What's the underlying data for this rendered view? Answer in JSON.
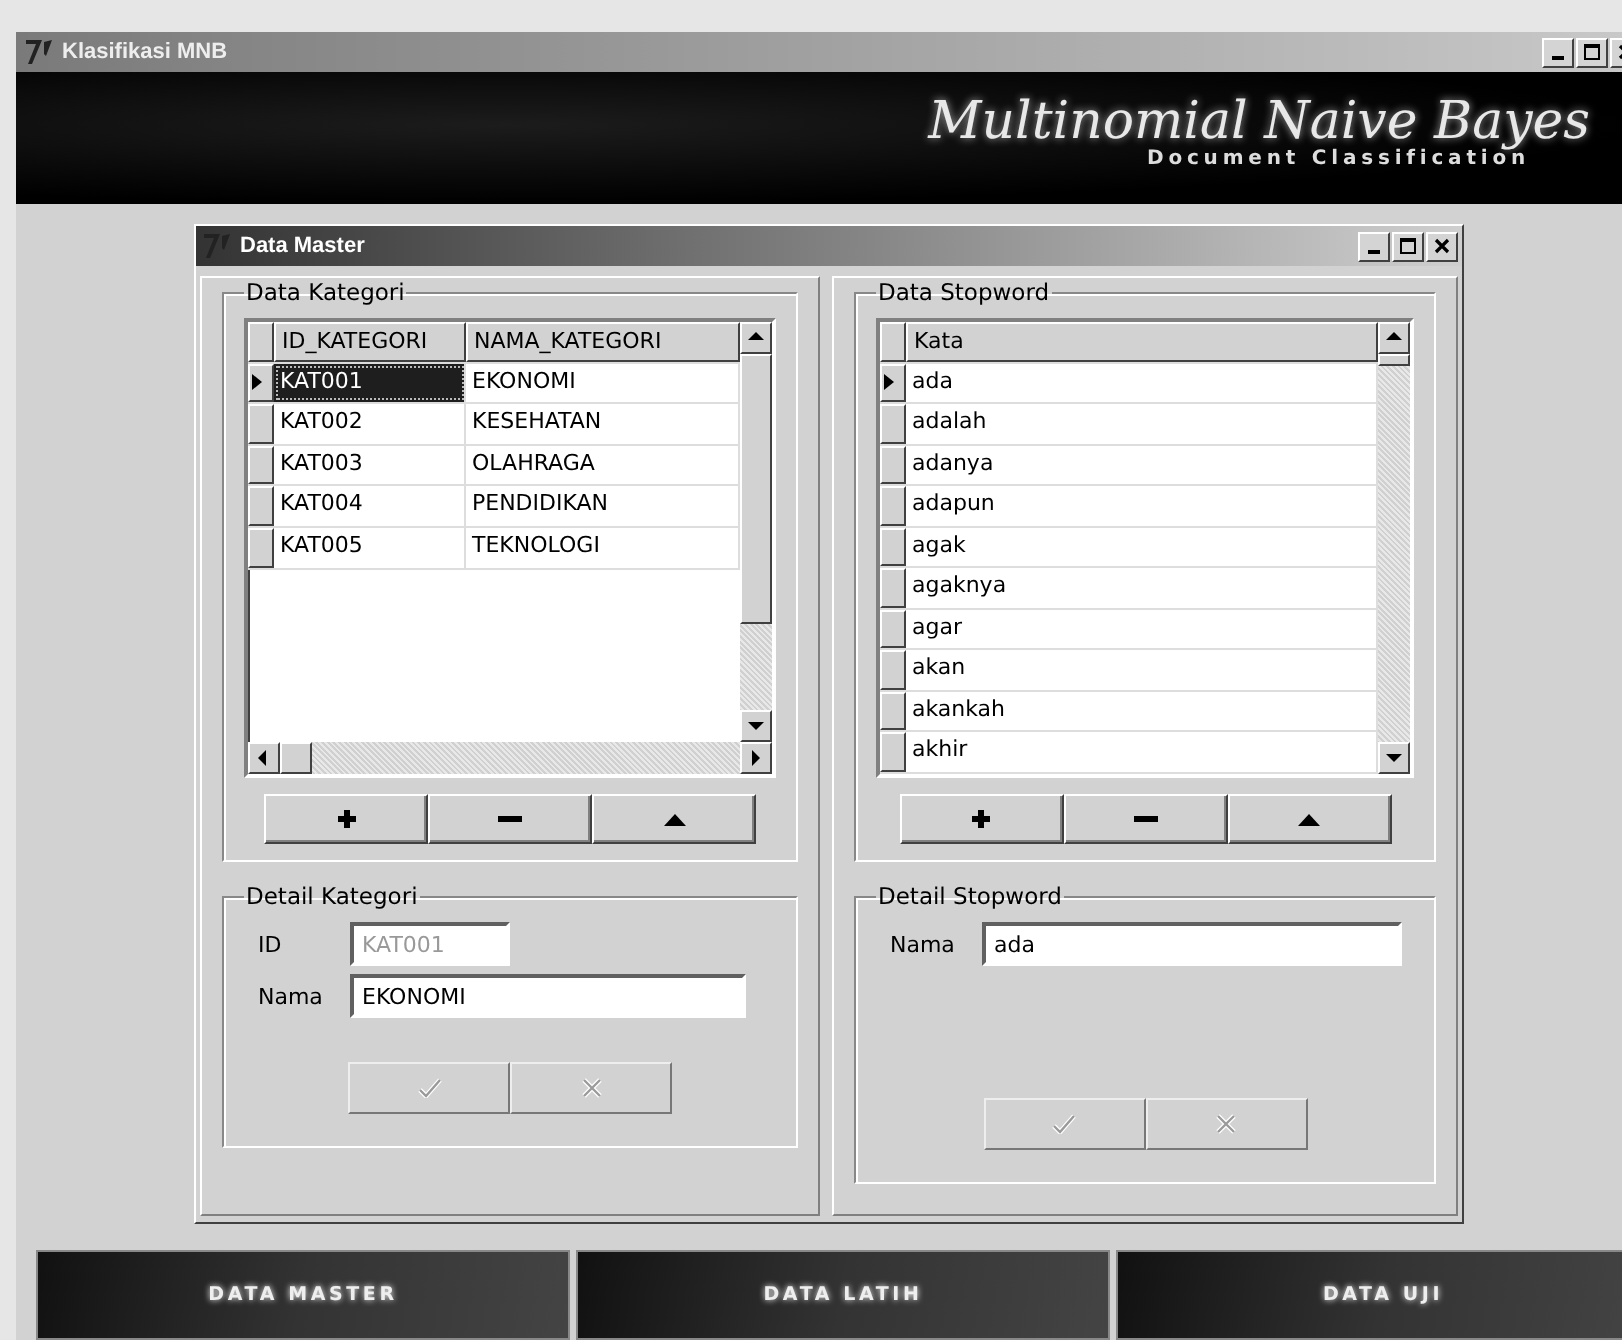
{
  "window": {
    "title": "Klasifikasi MNB"
  },
  "banner": {
    "title": "Multinomial Naive Bayes",
    "subtitle": "Document Classification"
  },
  "dialog": {
    "title": "Data Master"
  },
  "kategori": {
    "title": "Data Kategori",
    "columns": [
      "ID_KATEGORI",
      "NAMA_KATEGORI"
    ],
    "rows": [
      {
        "cells": [
          "KAT001",
          "EKONOMI"
        ],
        "selected": true,
        "focused": true
      },
      {
        "cells": [
          "KAT002",
          "KESEHATAN"
        ],
        "selected": false,
        "focused": false
      },
      {
        "cells": [
          "KAT003",
          "OLAHRAGA"
        ],
        "selected": false,
        "focused": false
      },
      {
        "cells": [
          "KAT004",
          "PENDIDIKAN"
        ],
        "selected": false,
        "focused": false
      },
      {
        "cells": [
          "KAT005",
          "TEKNOLOGI"
        ],
        "selected": false,
        "focused": false
      }
    ],
    "buttons": [
      {
        "kind": "add"
      },
      {
        "kind": "remove"
      },
      {
        "kind": "up"
      }
    ]
  },
  "stopword": {
    "title": "Data Stopword",
    "columns": [
      "Kata"
    ],
    "rows": [
      {
        "cells": [
          "ada"
        ],
        "selected": true
      },
      {
        "cells": [
          "adalah"
        ],
        "selected": false
      },
      {
        "cells": [
          "adanya"
        ],
        "selected": false
      },
      {
        "cells": [
          "adapun"
        ],
        "selected": false
      },
      {
        "cells": [
          "agak"
        ],
        "selected": false
      },
      {
        "cells": [
          "agaknya"
        ],
        "selected": false
      },
      {
        "cells": [
          "agar"
        ],
        "selected": false
      },
      {
        "cells": [
          "akan"
        ],
        "selected": false
      },
      {
        "cells": [
          "akankah"
        ],
        "selected": false
      },
      {
        "cells": [
          "akhir"
        ],
        "selected": false
      }
    ],
    "buttons": [
      {
        "kind": "add"
      },
      {
        "kind": "remove"
      },
      {
        "kind": "up"
      }
    ]
  },
  "detail_kategori": {
    "title": "Detail Kategori",
    "fields": [
      {
        "label": "ID",
        "value": "KAT001",
        "disabled": true
      },
      {
        "label": "Nama",
        "value": "EKONOMI",
        "disabled": false
      }
    ],
    "actions": [
      {
        "kind": "save",
        "disabled": true
      },
      {
        "kind": "cancel",
        "disabled": true
      }
    ]
  },
  "detail_stopword": {
    "title": "Detail Stopword",
    "fields": [
      {
        "label": "Nama",
        "value": "ada",
        "disabled": false
      }
    ],
    "actions": [
      {
        "kind": "save",
        "disabled": true
      },
      {
        "kind": "cancel",
        "disabled": true
      }
    ]
  },
  "nav": [
    {
      "label": "DATA MASTER"
    },
    {
      "label": "DATA LATIH"
    },
    {
      "label": "DATA UJI"
    }
  ]
}
